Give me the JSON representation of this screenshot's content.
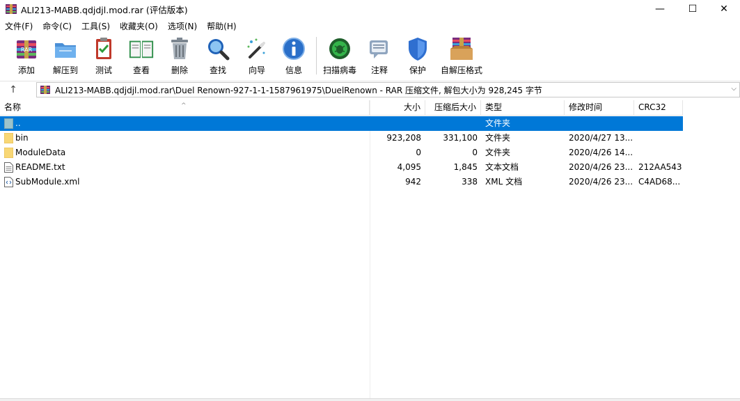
{
  "window": {
    "title": "ALI213-MABB.qdjdjl.mod.rar (评估版本)",
    "minimize": "—",
    "maximize": "☐",
    "close": "✕"
  },
  "menu": [
    "文件(F)",
    "命令(C)",
    "工具(S)",
    "收藏夹(O)",
    "选项(N)",
    "帮助(H)"
  ],
  "toolbar": {
    "add": "添加",
    "extract_to": "解压到",
    "test": "测试",
    "view": "查看",
    "delete": "删除",
    "find": "查找",
    "wizard": "向导",
    "info": "信息",
    "virus_scan": "扫描病毒",
    "comment": "注释",
    "protect": "保护",
    "sfx": "自解压格式"
  },
  "address": {
    "up_arrow": "↑",
    "path": "ALI213-MABB.qdjdjl.mod.rar\\Duel Renown-927-1-1-1587961975\\DuelRenown - RAR 压缩文件, 解包大小为 928,245 字节",
    "dropdown": "⌵"
  },
  "columns": {
    "name": "名称",
    "size": "大小",
    "packed": "压缩后大小",
    "type": "类型",
    "modified": "修改时间",
    "crc": "CRC32",
    "sort_arrow": "^"
  },
  "files": [
    {
      "name": "..",
      "size": "",
      "packed": "",
      "type": "文件夹",
      "modified": "",
      "crc": "",
      "icon": "parent-folder"
    },
    {
      "name": "bin",
      "size": "923,208",
      "packed": "331,100",
      "type": "文件夹",
      "modified": "2020/4/27 13...",
      "crc": "",
      "icon": "folder"
    },
    {
      "name": "ModuleData",
      "size": "0",
      "packed": "0",
      "type": "文件夹",
      "modified": "2020/4/26 14...",
      "crc": "",
      "icon": "folder"
    },
    {
      "name": "README.txt",
      "size": "4,095",
      "packed": "1,845",
      "type": "文本文档",
      "modified": "2020/4/26 23...",
      "crc": "212AA543",
      "icon": "text-file"
    },
    {
      "name": "SubModule.xml",
      "size": "942",
      "packed": "338",
      "type": "XML 文档",
      "modified": "2020/4/26 23...",
      "crc": "C4AD68...",
      "icon": "xml-file"
    }
  ],
  "colors": {
    "selection": "#0078d7",
    "folder": "#f8d775"
  }
}
